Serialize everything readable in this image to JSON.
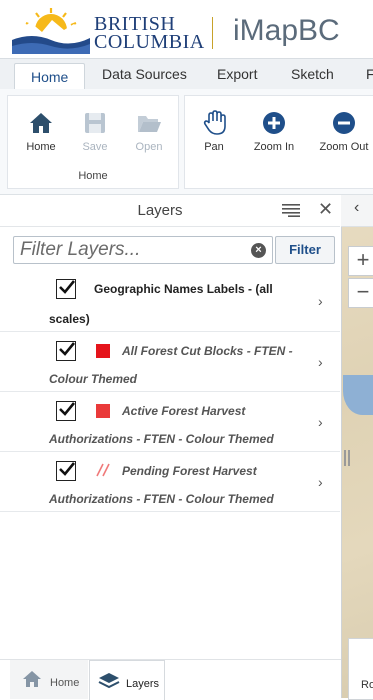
{
  "header": {
    "brand_line1": "BRITISH",
    "brand_line2": "COLUMBIA",
    "app_title": "iMapBC"
  },
  "ribbon_tabs": [
    "Home",
    "Data Sources",
    "Export",
    "Sketch",
    "F"
  ],
  "ribbon": {
    "home_group": {
      "label": "Home",
      "buttons": [
        "Home",
        "Save",
        "Open"
      ]
    },
    "nav_group": {
      "buttons": [
        "Pan",
        "Zoom In",
        "Zoom Out"
      ]
    }
  },
  "panel": {
    "title": "Layers",
    "filter_placeholder": "Filter Layers...",
    "filter_button": "Filter"
  },
  "layers": [
    {
      "line1": "Geographic Names Labels - (all",
      "line2": "scales)",
      "checked": true,
      "swatch": "none"
    },
    {
      "line1": "All Forest Cut Blocks - FTEN -",
      "line2": "Colour Themed",
      "checked": true,
      "swatch": "#e5141b"
    },
    {
      "line1": "Active Forest Harvest",
      "line2": "Authorizations - FTEN - Colour Themed",
      "checked": true,
      "swatch": "#ea3a3a"
    },
    {
      "line1": "Pending Forest Harvest",
      "line2": "Authorizations - FTEN - Colour Themed",
      "checked": true,
      "swatch": "hatch"
    }
  ],
  "map": {
    "zoom_in": "+",
    "zoom_out": "−",
    "bottom_label": "Ro"
  },
  "bottom_tabs": [
    "Home",
    "Layers"
  ],
  "colors": {
    "accent_blue": "#1f4f8a",
    "brand_gold": "#c8a22a"
  }
}
